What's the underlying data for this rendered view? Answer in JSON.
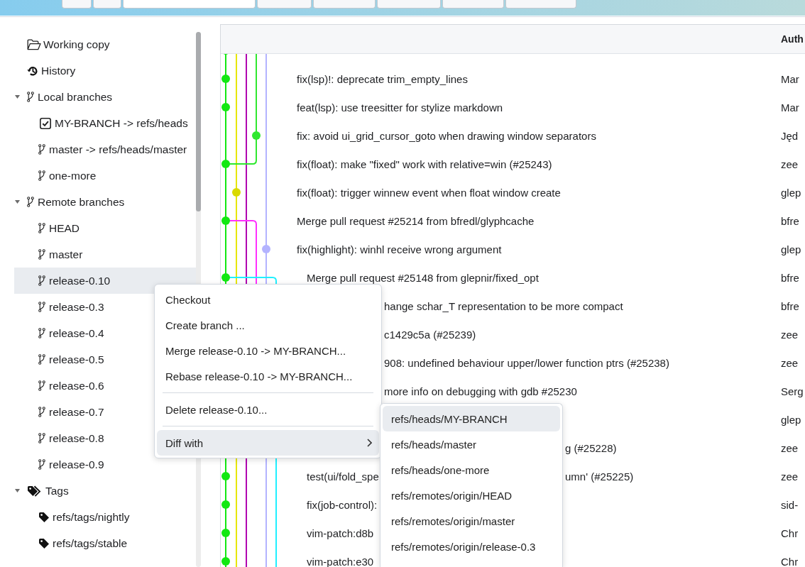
{
  "toolbar": {
    "controls": [
      {
        "kind": "button"
      },
      {
        "kind": "button"
      },
      {
        "kind": "field"
      },
      {
        "kind": "button"
      },
      {
        "kind": "button"
      },
      {
        "kind": "button"
      },
      {
        "kind": "button"
      },
      {
        "kind": "button"
      }
    ]
  },
  "sidebar": {
    "items": [
      {
        "label": "Working copy",
        "kind": "working-copy",
        "selected": false
      },
      {
        "label": "History",
        "kind": "history",
        "selected": false
      },
      {
        "label": "Local branches",
        "kind": "branch-group",
        "selected": false,
        "expanded": true,
        "children": [
          {
            "label": "MY-BRANCH -> refs/heads",
            "kind": "current-branch",
            "selected": false
          },
          {
            "label": "master -> refs/heads/master",
            "kind": "branch",
            "selected": false
          },
          {
            "label": "one-more",
            "kind": "branch",
            "selected": false
          }
        ]
      },
      {
        "label": "Remote branches",
        "kind": "branch-group",
        "selected": false,
        "expanded": true,
        "children": [
          {
            "label": "HEAD",
            "kind": "branch",
            "selected": false
          },
          {
            "label": "master",
            "kind": "branch",
            "selected": false
          },
          {
            "label": "release-0.10",
            "kind": "branch",
            "selected": true
          },
          {
            "label": "release-0.3",
            "kind": "branch",
            "selected": false
          },
          {
            "label": "release-0.4",
            "kind": "branch",
            "selected": false
          },
          {
            "label": "release-0.5",
            "kind": "branch",
            "selected": false
          },
          {
            "label": "release-0.6",
            "kind": "branch",
            "selected": false
          },
          {
            "label": "release-0.7",
            "kind": "branch",
            "selected": false
          },
          {
            "label": "release-0.8",
            "kind": "branch",
            "selected": false
          },
          {
            "label": "release-0.9",
            "kind": "branch",
            "selected": false
          }
        ]
      },
      {
        "label": "Tags",
        "kind": "tag-group",
        "selected": false,
        "expanded": true,
        "children": [
          {
            "label": "refs/tags/nightly",
            "kind": "tag",
            "selected": false
          },
          {
            "label": "refs/tags/stable",
            "kind": "tag",
            "selected": false
          }
        ]
      }
    ]
  },
  "commits": {
    "columns": [
      {
        "label": "Auth"
      }
    ],
    "rows": [
      {
        "message": "fix(lsp)!: deprecate trim_empty_lines",
        "author": "Mar"
      },
      {
        "message": "feat(lsp): use treesitter for stylize markdown",
        "author": "Mar"
      },
      {
        "message": "fix: avoid ui_grid_cursor_goto when drawing window separators",
        "author": "Jęd"
      },
      {
        "message": "fix(float): make \"fixed\" work with relative=win (#25243)",
        "author": "zee"
      },
      {
        "message": "fix(float): trigger winnew event when float window create",
        "author": "glep"
      },
      {
        "message": "Merge pull request #25214 from bfredl/glyphcache",
        "author": "bfre"
      },
      {
        "message": "fix(highlight): winhl receive wrong argument",
        "author": "glep"
      },
      {
        "message": "Merge pull request #25148 from glepnir/fixed_opt",
        "author": "bfre"
      },
      {
        "message_tail": "hange schar_T representation to be more compact",
        "author": "bfre"
      },
      {
        "message_tail": "c1429c5a (#25239)",
        "author": "zee"
      },
      {
        "message_tail": "908: undefined behaviour upper/lower function ptrs (#25238)",
        "author": "zee"
      },
      {
        "message_tail": "more info on debugging with gdb #25230",
        "author": "Serg"
      },
      {
        "author": "glep"
      },
      {
        "message_tail": "g (#25228)",
        "author": "zee"
      },
      {
        "message": "test(ui/fold_spe",
        "message_tail": "umn' (#25225)",
        "author": "zee"
      },
      {
        "message": "fix(job-control):",
        "author": "sid-"
      },
      {
        "message": "vim-patch:d8b",
        "author": "Chr"
      },
      {
        "message": "vim-patch:e30",
        "author": "Chr"
      }
    ]
  },
  "context_menu": {
    "items": [
      {
        "kind": "item",
        "label": "Checkout",
        "selected": false
      },
      {
        "kind": "item",
        "label": "Create branch ...",
        "selected": false
      },
      {
        "kind": "item",
        "label": "Merge release-0.10 -> MY-BRANCH...",
        "selected": false
      },
      {
        "kind": "item",
        "label": "Rebase release-0.10 -> MY-BRANCH...",
        "selected": false
      },
      {
        "kind": "separator"
      },
      {
        "kind": "item",
        "label": "Delete release-0.10...",
        "selected": false
      },
      {
        "kind": "separator"
      },
      {
        "kind": "submenu",
        "label": "Diff with",
        "selected": true
      }
    ]
  },
  "submenu": {
    "items": [
      {
        "label": "refs/heads/MY-BRANCH",
        "selected": true
      },
      {
        "label": "refs/heads/master",
        "selected": false
      },
      {
        "label": "refs/heads/one-more",
        "selected": false
      },
      {
        "label": "refs/remotes/origin/HEAD",
        "selected": false
      },
      {
        "label": "refs/remotes/origin/master",
        "selected": false
      },
      {
        "label": "refs/remotes/origin/release-0.3",
        "selected": false
      }
    ]
  }
}
